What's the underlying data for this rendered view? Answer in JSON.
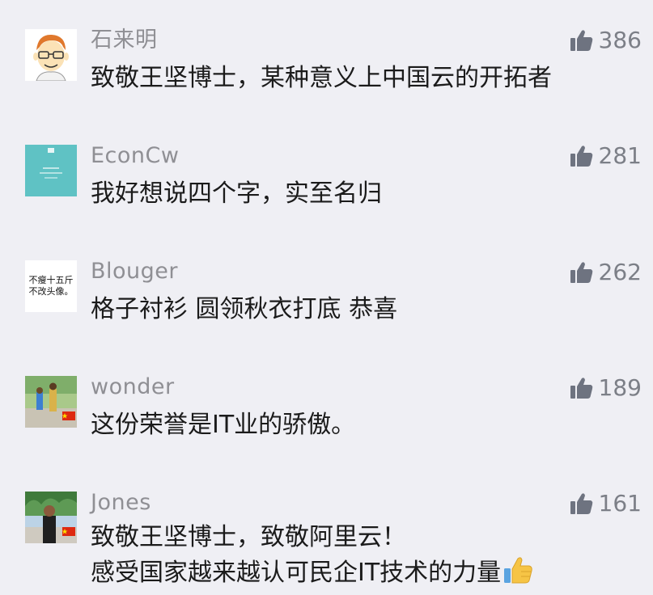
{
  "comments": [
    {
      "nickname": "石来明",
      "likes": "386",
      "lines": [
        "致敬王坚博士，某种意义上中国云的开拓者"
      ],
      "avatar": {
        "icon": "cartoon-face-avatar"
      }
    },
    {
      "nickname": "EconCw",
      "likes": "281",
      "lines": [
        "我好想说四个字，实至名归"
      ],
      "avatar": {
        "icon": "teal-book-avatar"
      }
    },
    {
      "nickname": "Blouger",
      "likes": "262",
      "lines": [
        "格子衬衫 圆领秋衣打底 恭喜"
      ],
      "avatar": {
        "icon": "text-avatar",
        "text_line_1": "不瘦十五斤",
        "text_line_2": "不改头像。"
      }
    },
    {
      "nickname": "wonder",
      "likes": "189",
      "lines": [
        "这份荣誉是IT业的骄傲。"
      ],
      "avatar": {
        "icon": "photo-avatar-with-flag"
      }
    },
    {
      "nickname": "Jones",
      "likes": "161",
      "lines": [
        "致敬王坚博士，致敬阿里云！",
        "感受国家越来越认可民企IT技术的力量"
      ],
      "emoji": "thumbs-up-emoji",
      "avatar": {
        "icon": "photo-avatar-with-flag"
      }
    }
  ],
  "colors": {
    "background": "#efeff4",
    "nickname": "#8f8f94",
    "like_icon": "#6e7380",
    "content": "#1b1b1b",
    "emoji_thumb": "#f6c445"
  }
}
